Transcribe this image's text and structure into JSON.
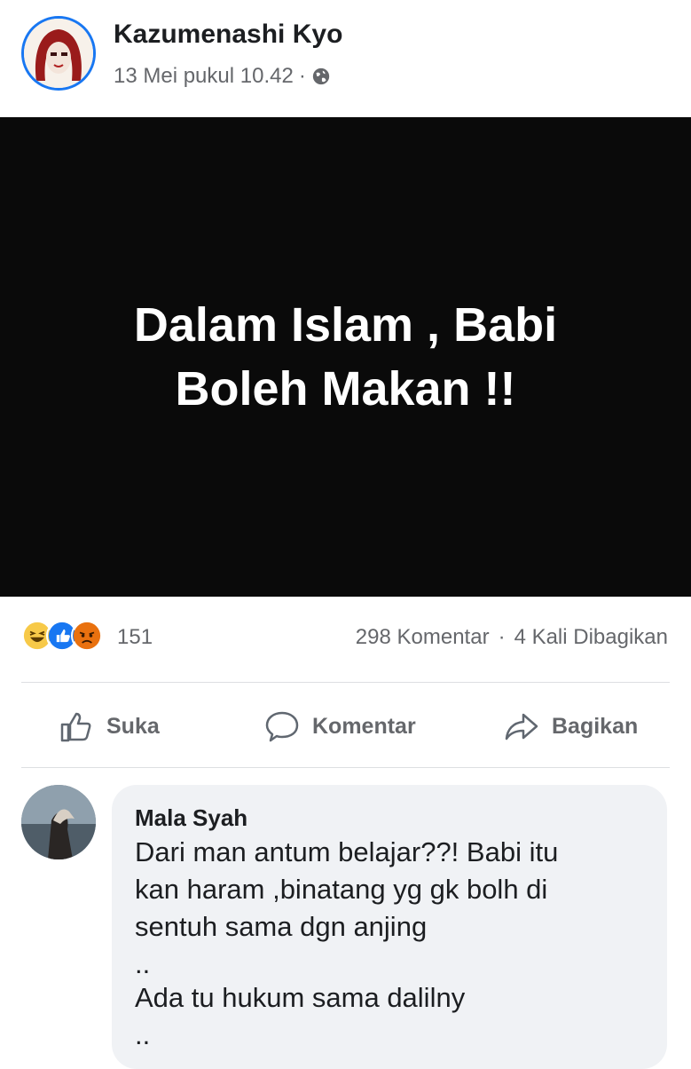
{
  "post": {
    "author": "Kazumenashi Kyo",
    "timestamp": "13 Mei pukul 10.42",
    "separator": "·",
    "privacy_icon": "globe-icon",
    "image_text_line1": "Dalam Islam , Babi",
    "image_text_line2": "Boleh Makan !!"
  },
  "reactions": {
    "icons": [
      "haha-icon",
      "like-icon",
      "angry-icon"
    ],
    "count": "151",
    "comments": "298 Komentar",
    "dot": "·",
    "shares": "4 Kali Dibagikan"
  },
  "actions": {
    "like": "Suka",
    "comment": "Komentar",
    "share": "Bagikan"
  },
  "comment": {
    "author": "Mala Syah",
    "line1": "Dari man antum belajar??! Babi itu",
    "line2": "kan haram ,binatang yg gk bolh di",
    "line3": "sentuh sama dgn anjing",
    "line4": "..",
    "line5": "Ada tu hukum sama dalilny",
    "line6": ".."
  },
  "colors": {
    "accent": "#1877f2",
    "image_bg": "#0a0a0a",
    "muted_text": "#65676b",
    "bubble_bg": "#f0f2f5"
  }
}
